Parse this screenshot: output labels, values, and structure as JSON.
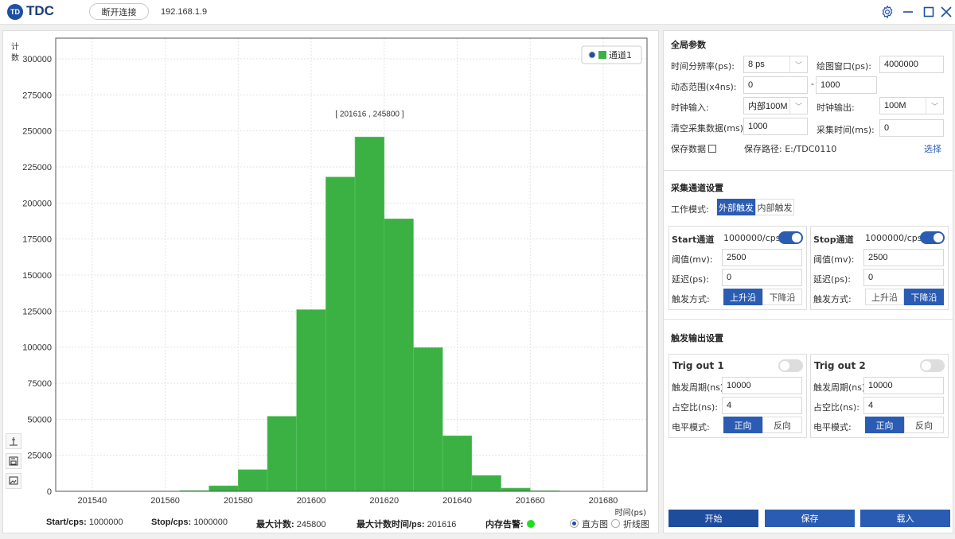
{
  "app": {
    "title": "TDC",
    "logo_text": "TD",
    "disconnect_label": "断开连接",
    "ip": "192.168.1.9"
  },
  "window_controls": [
    "gear-icon",
    "minimize-icon",
    "maximize-icon",
    "close-icon"
  ],
  "chart_data": {
    "type": "bar",
    "title": "",
    "xlabel": "时间(ps)",
    "ylabel": "计数",
    "xlim": [
      201530,
      201692
    ],
    "ylim": [
      0,
      300000
    ],
    "x_ticks": [
      201540,
      201560,
      201580,
      201600,
      201620,
      201640,
      201660,
      201680
    ],
    "y_ticks": [
      0,
      25000,
      50000,
      75000,
      100000,
      125000,
      150000,
      175000,
      200000,
      225000,
      250000,
      275000,
      300000
    ],
    "bin_width": 8,
    "grid": true,
    "legend": {
      "position": "top-right",
      "entries": [
        "通道1"
      ]
    },
    "annotation": "[ 201616 , 245800 ]",
    "color": "#3bb143",
    "series": [
      {
        "name": "通道1",
        "x": [
          201564,
          201572,
          201580,
          201588,
          201596,
          201604,
          201612,
          201620,
          201628,
          201636,
          201644,
          201652,
          201660
        ],
        "values": [
          500,
          3800,
          15000,
          52000,
          126000,
          218000,
          245800,
          189000,
          99700,
          38500,
          11000,
          2200,
          400
        ]
      }
    ]
  },
  "chart_tools": [
    "axis-marker-icon",
    "save-icon",
    "export-image-icon"
  ],
  "stats": {
    "start_label": "Start/cps:",
    "start_value": "1000000",
    "stop_label": "Stop/cps:",
    "stop_value": "1000000",
    "max_count_label": "最大计数:",
    "max_count_value": "245800",
    "max_time_label": "最大计数时间/ps:",
    "max_time_value": "201616",
    "mem_label": "内存告警:",
    "mem_status_color": "#22dd22"
  },
  "view_mode": {
    "options": [
      "直方图",
      "折线图"
    ],
    "selected": "直方图"
  },
  "global": {
    "title": "全局参数",
    "resolution_label": "时间分辨率(ps):",
    "resolution_value": "8 ps",
    "plot_window_label": "绘图窗口(ps):",
    "plot_window_value": "4000000",
    "range_label": "动态范围(x4ns):",
    "range_min": "0",
    "range_dash": "-",
    "range_max": "1000",
    "clock_in_label": "时钟输入:",
    "clock_in_value": "内部100M",
    "clock_out_label": "时钟输出:",
    "clock_out_value": "100M",
    "clear_label": "清空采集数据(ms):",
    "clear_value": "1000",
    "acq_time_label": "采集时间(ms):",
    "acq_time_value": "0",
    "save_data_label": "保存数据",
    "save_data_checked": false,
    "save_path_label": "保存路径: E:/TDC0110",
    "choose_label": "选择"
  },
  "channels": {
    "title": "采集通道设置",
    "mode_label": "工作模式:",
    "mode_options": [
      "外部触发",
      "内部触发"
    ],
    "mode_selected": "外部触发",
    "start": {
      "title": "Start通道",
      "rate": "1000000/cps",
      "enabled": true,
      "threshold_label": "阈值(mv):",
      "threshold": "2500",
      "delay_label": "延迟(ps):",
      "delay": "0",
      "trigger_label": "触发方式:",
      "trigger_options": [
        "上升沿",
        "下降沿"
      ],
      "trigger_selected": "上升沿"
    },
    "stop": {
      "title": "Stop通道",
      "rate": "1000000/cps",
      "enabled": true,
      "threshold_label": "阈值(mv):",
      "threshold": "2500",
      "delay_label": "延迟(ps):",
      "delay": "0",
      "trigger_label": "触发方式:",
      "trigger_options": [
        "上升沿",
        "下降沿"
      ],
      "trigger_selected": "下降沿"
    }
  },
  "trig_out": {
    "title": "触发输出设置",
    "out1": {
      "title": "Trig out 1",
      "enabled": false,
      "period_label": "触发周期(ns):",
      "period": "10000",
      "duty_label": "占空比(ns):",
      "duty": "4",
      "level_label": "电平模式:",
      "level_options": [
        "正向",
        "反向"
      ],
      "level_selected": "正向"
    },
    "out2": {
      "title": "Trig out 2",
      "enabled": false,
      "period_label": "触发周期(ns):",
      "period": "10000",
      "duty_label": "占空比(ns):",
      "duty": "4",
      "level_label": "电平模式:",
      "level_options": [
        "正向",
        "反向"
      ],
      "level_selected": "正向"
    }
  },
  "actions": {
    "start": "开始",
    "save": "保存",
    "load": "载入"
  }
}
